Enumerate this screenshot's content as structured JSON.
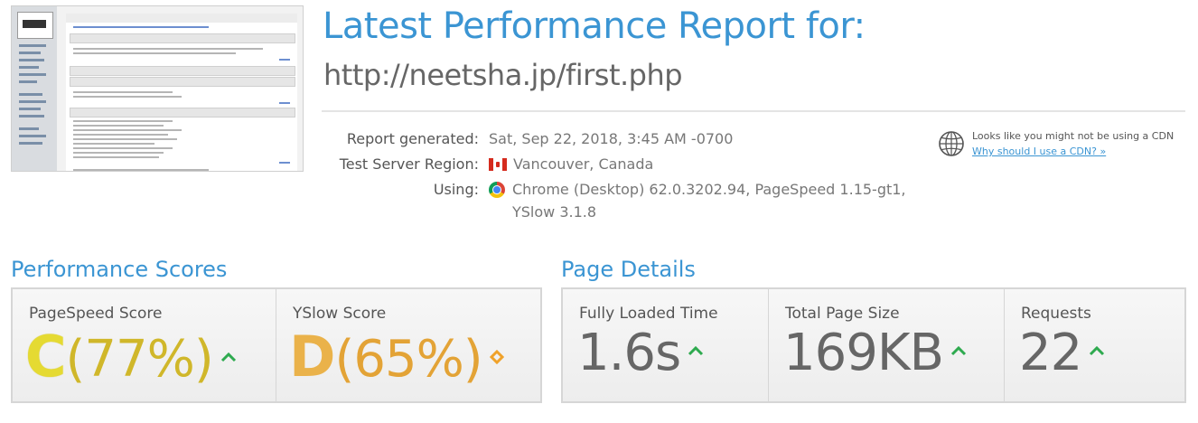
{
  "header": {
    "title": "Latest Performance Report for:",
    "url": "http://neetsha.jp/first.php"
  },
  "report": {
    "generated_label": "Report generated:",
    "generated_value": "Sat, Sep 22, 2018, 3:45 AM -0700",
    "region_label": "Test Server Region:",
    "region_value": "Vancouver, Canada",
    "using_label": "Using:",
    "using_line1": "Chrome (Desktop) 62.0.3202.94, PageSpeed 1.15-gt1,",
    "using_line2": "YSlow 3.1.8"
  },
  "cdn": {
    "message": "Looks like you might not be using a CDN",
    "link": "Why should I use a CDN? »"
  },
  "performance": {
    "title": "Performance Scores",
    "pagespeed_label": "PageSpeed Score",
    "pagespeed_grade": "C",
    "pagespeed_pct": "(77%)",
    "yslow_label": "YSlow Score",
    "yslow_grade": "D",
    "yslow_pct": "(65%)"
  },
  "details": {
    "title": "Page Details",
    "load_label": "Fully Loaded Time",
    "load_value": "1.6s",
    "size_label": "Total Page Size",
    "size_value": "169KB",
    "requests_label": "Requests",
    "requests_value": "22"
  },
  "icons": {
    "pagespeed_trend": "arrow-up-icon",
    "yslow_trend": "diamond-icon",
    "load_trend": "arrow-up-icon",
    "size_trend": "arrow-up-icon",
    "requests_trend": "arrow-up-icon",
    "region_flag": "canada-flag-icon",
    "browser": "chrome-icon",
    "cdn": "globe-icon"
  },
  "colors": {
    "accent": "#3b95d3",
    "grade_c": "#e5da32",
    "grade_d": "#eab24a",
    "trend_up": "#2eaa4f",
    "trend_neutral": "#f0a22a"
  }
}
